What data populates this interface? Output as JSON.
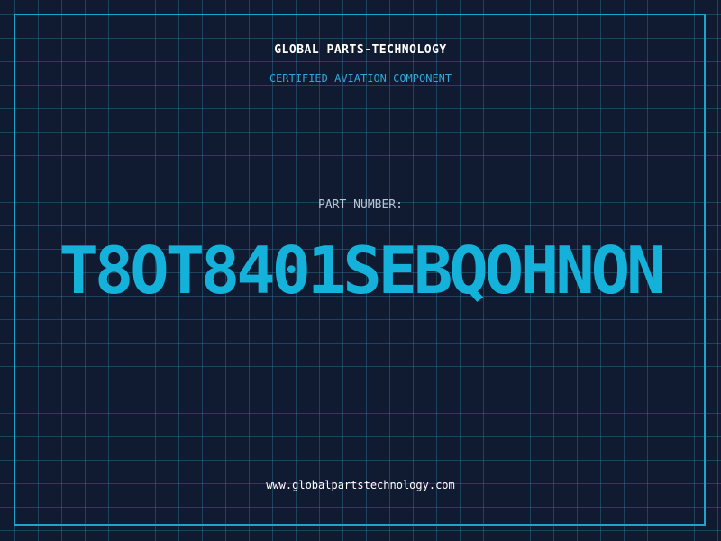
{
  "label": {
    "company": "GLOBAL PARTS-TECHNOLOGY",
    "tagline": "CERTIFIED AVIATION COMPONENT",
    "part_number_label": "PART NUMBER:",
    "part_number": "T8OT8401SEBQOHNON",
    "website": "www.globalpartstechnology.com"
  },
  "colors": {
    "background": "#101a30",
    "grid": "#2c7896",
    "border": "#1aa6cc",
    "accent": "#14b2da",
    "tagline": "#2ea8d8",
    "label": "#b7c4d4",
    "text": "#ffffff"
  }
}
